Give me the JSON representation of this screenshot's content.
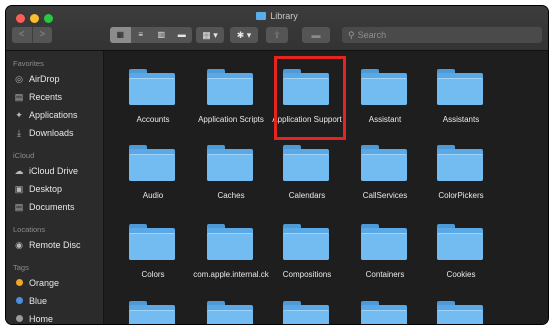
{
  "window": {
    "title": "Library"
  },
  "toolbar": {
    "back": "<",
    "forward": ">",
    "view_icons": "▦",
    "view_list": "≡",
    "view_columns": "▥",
    "view_gallery": "▬",
    "group_menu": "▦ ▾",
    "action_menu": "✱ ▾",
    "share": "⇪",
    "tag": "▬",
    "search_placeholder": "Search"
  },
  "sidebar": {
    "favorites_label": "Favorites",
    "favorites": [
      {
        "label": "AirDrop",
        "icon": "airdrop-icon"
      },
      {
        "label": "Recents",
        "icon": "recents-icon"
      },
      {
        "label": "Applications",
        "icon": "applications-icon"
      },
      {
        "label": "Downloads",
        "icon": "downloads-icon"
      }
    ],
    "icloud_label": "iCloud",
    "icloud": [
      {
        "label": "iCloud Drive",
        "icon": "cloud-icon"
      },
      {
        "label": "Desktop",
        "icon": "desktop-icon"
      },
      {
        "label": "Documents",
        "icon": "documents-icon"
      }
    ],
    "locations_label": "Locations",
    "locations": [
      {
        "label": "Remote Disc",
        "icon": "disc-icon"
      }
    ],
    "tags_label": "Tags",
    "tags": [
      {
        "label": "Orange",
        "color": "#f5a623"
      },
      {
        "label": "Blue",
        "color": "#4a90e2"
      },
      {
        "label": "Home",
        "color": "#9b9b9b"
      }
    ]
  },
  "folders": [
    "Accounts",
    "Application Scripts",
    "Application Support",
    "Assistant",
    "Assistants",
    "Audio",
    "Caches",
    "Calendars",
    "CallServices",
    "ColorPickers",
    "Colors",
    "com.apple.internal.ck",
    "Compositions",
    "Containers",
    "Cookies",
    "",
    "",
    "",
    "",
    ""
  ],
  "highlighted_folder": "Application Support",
  "colors": {
    "folder": "#5aa9e6",
    "highlight": "#e52420"
  }
}
